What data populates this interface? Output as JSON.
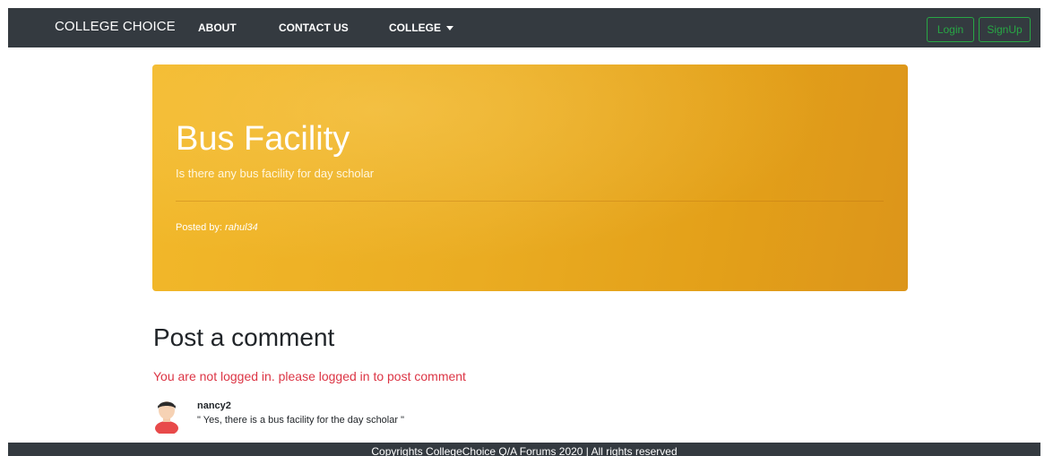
{
  "navbar": {
    "brand": "COLLEGE CHOICE",
    "links": [
      "ABOUT",
      "CONTACT US",
      "COLLEGE"
    ],
    "login_label": "Login",
    "signup_label": "SignUp",
    "bg_color": "#343a40",
    "button_color": "#28a745"
  },
  "thread": {
    "title": "Bus Facility",
    "description": "Is there any bus facility for day scholar",
    "posted_by_label": "Posted by:",
    "posted_by_user": "rahul34"
  },
  "comments_section": {
    "heading": "Post a comment",
    "login_message": "You are not logged in. please logged in to post comment",
    "comments": [
      {
        "user": "nancy2",
        "text": "\" Yes, there is a bus facility for the day scholar \""
      }
    ]
  },
  "footer": {
    "text": "Copyrights CollegeChoice Q/A Forums 2020 | All rights reserved"
  }
}
